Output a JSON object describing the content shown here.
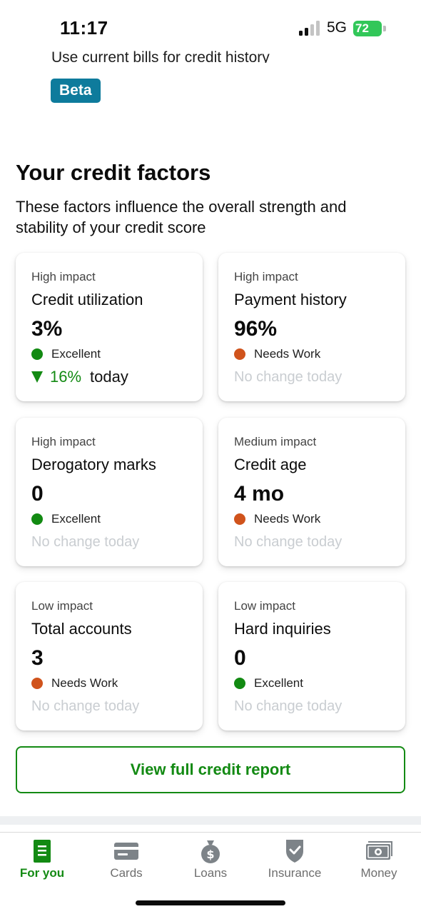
{
  "status": {
    "time": "11:17",
    "network": "5G",
    "battery": "72"
  },
  "beta_section": {
    "cut_text": "Use current bills for credit history",
    "badge": "Beta"
  },
  "factors_section": {
    "title": "Your credit factors",
    "subtitle": "These factors influence the overall strength and stability of your credit score"
  },
  "factors": [
    {
      "impact": "High impact",
      "name": "Credit utilization",
      "value": "3%",
      "status": "Excellent",
      "status_color": "#128a12",
      "change_pct": "16%",
      "change_word": "today"
    },
    {
      "impact": "High impact",
      "name": "Payment history",
      "value": "96%",
      "status": "Needs Work",
      "status_color": "#d0531c",
      "change": "No change today"
    },
    {
      "impact": "High impact",
      "name": "Derogatory marks",
      "value": "0",
      "status": "Excellent",
      "status_color": "#128a12",
      "change": "No change today"
    },
    {
      "impact": "Medium impact",
      "name": "Credit age",
      "value": "4 mo",
      "status": "Needs Work",
      "status_color": "#d0531c",
      "change": "No change today"
    },
    {
      "impact": "Low impact",
      "name": "Total accounts",
      "value": "3",
      "status": "Needs Work",
      "status_color": "#d0531c",
      "change": "No change today"
    },
    {
      "impact": "Low impact",
      "name": "Hard inquiries",
      "value": "0",
      "status": "Excellent",
      "status_color": "#128a12",
      "change": "No change today"
    }
  ],
  "view_report_label": "View full credit report",
  "tabs": [
    {
      "label": "For you",
      "icon": "document-icon",
      "active": true
    },
    {
      "label": "Cards",
      "icon": "credit-card-icon",
      "active": false
    },
    {
      "label": "Loans",
      "icon": "money-bag-icon",
      "active": false
    },
    {
      "label": "Insurance",
      "icon": "shield-check-icon",
      "active": false
    },
    {
      "label": "Money",
      "icon": "cash-icon",
      "active": false
    }
  ],
  "colors": {
    "brand_green": "#138a13",
    "needs_work": "#d0531c",
    "beta": "#0e7b9c"
  }
}
